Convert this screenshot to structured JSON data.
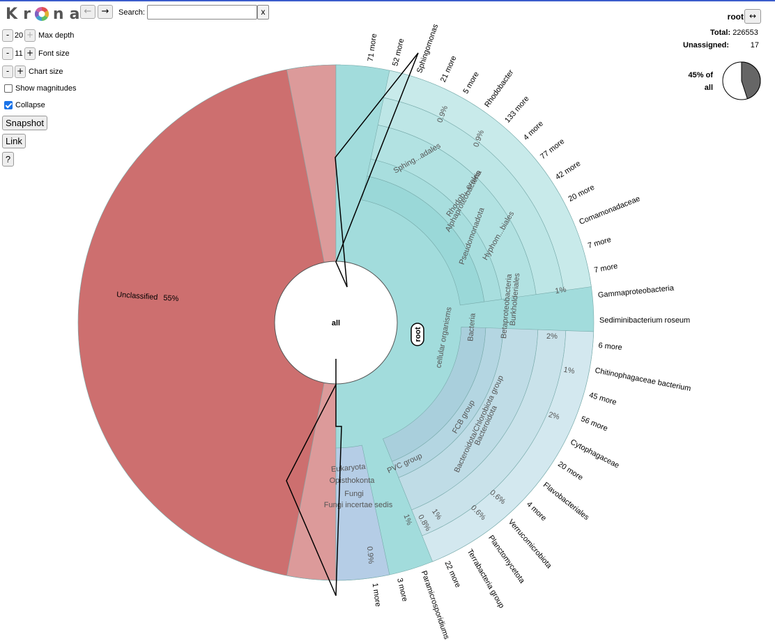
{
  "app": {
    "logo_letters": [
      "K",
      "r",
      "n",
      "a"
    ],
    "colors": {
      "top_bar": "#3b5ccc",
      "unclassified": "#cd6f6f",
      "unclassified_light": "#dc9a9a",
      "bacteria": "#a2dcdc",
      "other": "#bcd8e2"
    }
  },
  "nav": {
    "back_icon": "←",
    "forward_icon": "→",
    "back_enabled": false,
    "forward_enabled": true
  },
  "search": {
    "label": "Search:",
    "value": "",
    "placeholder": "",
    "clear_label": "x"
  },
  "controls": {
    "max_depth": {
      "minus": "-",
      "value": "20",
      "plus": "+",
      "label": "Max depth"
    },
    "font_size": {
      "minus": "-",
      "value": "11",
      "plus": "+",
      "label": "Font size"
    },
    "chart_size": {
      "minus": "-",
      "plus": "+",
      "label": "Chart size"
    },
    "show_magnitudes": {
      "label": "Show magnitudes",
      "checked": false
    },
    "collapse": {
      "label": "Collapse",
      "checked": true
    },
    "snapshot_label": "Snapshot",
    "link_label": "Link",
    "help_label": "?"
  },
  "details": {
    "node": "root",
    "expand_icon": "↔",
    "total_label": "Total:",
    "total_value": "226553",
    "unassigned_label": "Unassigned:",
    "unassigned_value": "17",
    "pct_line1": "45% of",
    "pct_line2": "all",
    "pct_fraction": 0.45
  },
  "chart": {
    "center_label": "all",
    "root_label": "root",
    "unclassified_label": "Unclassified",
    "unclassified_pct": "55%",
    "unclassified_fraction": 0.55,
    "inner_labels": [
      "cellular organisms",
      "Bacteria",
      "Pseudomonadota",
      "Alphaproteobacteria",
      "Betaproteobacteria",
      "Burkholderiales",
      "Rhodob...erales",
      "Hyphom...biales",
      "Sphing...adales",
      "FCB group",
      "Bacteroidota/Chlorobiota group",
      "Bacteroidota",
      "PVC group",
      "Eukaryota",
      "Opisthokonta",
      "Fungi",
      "Fungi incertae sedis"
    ],
    "outer_labels": [
      "71 more",
      "52 more",
      "Sphingomonas",
      "21 more",
      "5 more",
      "Rhodobacter",
      "133 more",
      "4 more",
      "77 more",
      "42 more",
      "20 more",
      "Comamonadaceae",
      "7 more",
      "7 more",
      "Gammaproteobacteria",
      "Sediminibacterium roseum",
      "6 more",
      "Chitinophagaceae bacterium",
      "45 more",
      "56 more",
      "Cytophagaceae",
      "20 more",
      "Flavobacteriales",
      "4 more",
      "Verrucomicrobiota",
      "Planctomycetota",
      "Terrabacteria group",
      "22 more",
      "Paramicrosporidiums",
      "3 more",
      "1 more"
    ],
    "pct_labels": [
      "0.9%",
      "0.9%",
      "1%",
      "2%",
      "1%",
      "2%",
      "0.6%",
      "0.6%",
      "1%",
      "0.8%",
      "1%",
      "0.9%"
    ]
  }
}
